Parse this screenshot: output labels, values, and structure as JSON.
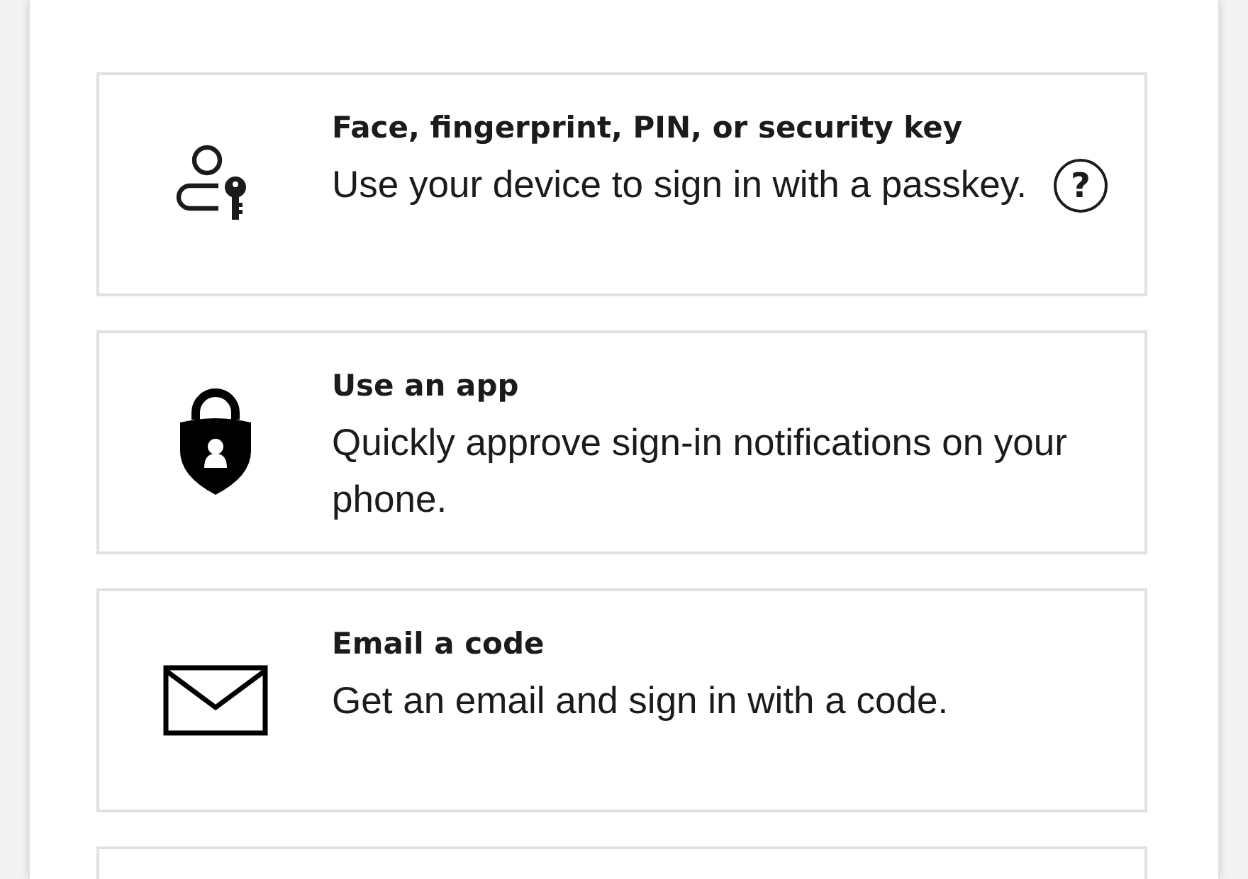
{
  "options": [
    {
      "kind": "passkey",
      "title": "Face, fingerprint, PIN, or security key",
      "description": "Use your device to sign in with a passkey.",
      "help": "?"
    },
    {
      "kind": "app",
      "title": "Use an app",
      "description": "Quickly approve sign-in notifications on your phone."
    },
    {
      "kind": "email",
      "title": "Email a code",
      "description": "Get an email and sign in with a  code."
    },
    {
      "kind": "cut"
    }
  ]
}
